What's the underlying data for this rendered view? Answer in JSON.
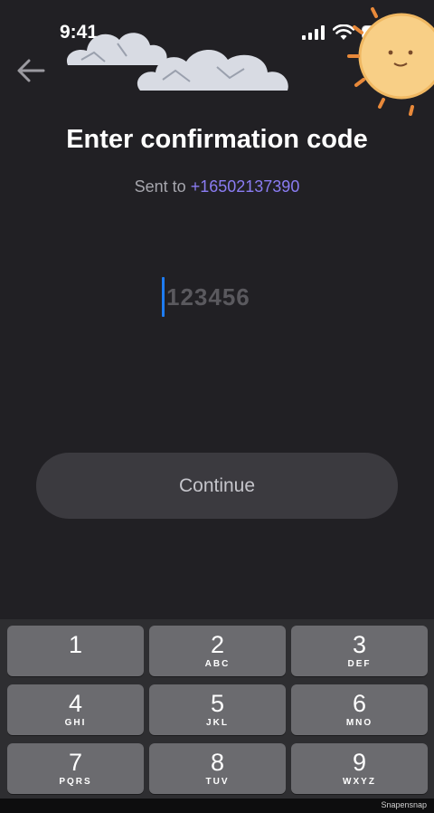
{
  "status_bar": {
    "time": "9:41"
  },
  "header": {
    "title": "Enter confirmation code"
  },
  "subtitle": {
    "label": "Sent to",
    "phone": "+16502137390"
  },
  "code_input": {
    "placeholder": "123456",
    "value": ""
  },
  "continue_button": {
    "label": "Continue"
  },
  "keypad": {
    "keys": [
      {
        "digit": "1",
        "letters": ""
      },
      {
        "digit": "2",
        "letters": "ABC"
      },
      {
        "digit": "3",
        "letters": "DEF"
      },
      {
        "digit": "4",
        "letters": "GHI"
      },
      {
        "digit": "5",
        "letters": "JKL"
      },
      {
        "digit": "6",
        "letters": "MNO"
      },
      {
        "digit": "7",
        "letters": "PQRS"
      },
      {
        "digit": "8",
        "letters": "TUV"
      },
      {
        "digit": "9",
        "letters": "WXYZ"
      }
    ]
  },
  "watermark": "Snapensnap",
  "colors": {
    "background": "#212024",
    "accent_phone": "#8a7cf2",
    "caret": "#1e7cf2",
    "button": "#3b3a3f",
    "key": "#6b6b6f",
    "keypad_bg": "#2e2e31"
  }
}
